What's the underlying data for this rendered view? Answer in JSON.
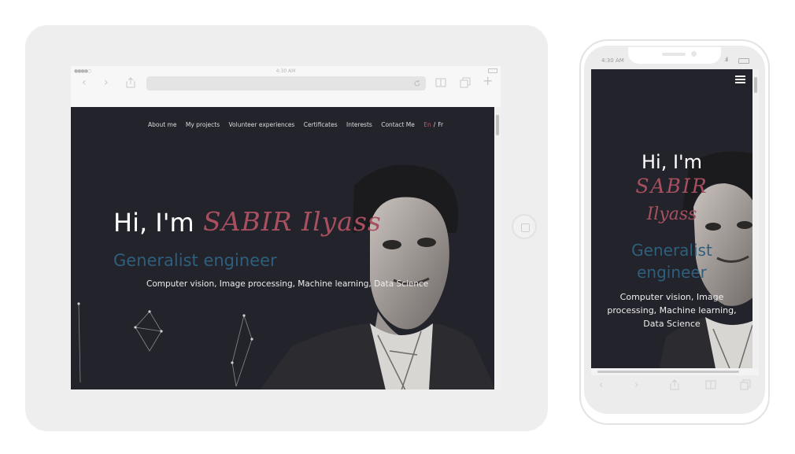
{
  "tablet": {
    "status_time": "4:30 AM",
    "nav": {
      "items": [
        "About me",
        "My projects",
        "Volunteer experiences",
        "Certificates",
        "Interests",
        "Contact Me"
      ],
      "lang_en": "En",
      "lang_sep": "/",
      "lang_fr": "Fr"
    },
    "hero": {
      "greeting": "Hi, I'm",
      "name": "SABIR Ilyass",
      "role": "Generalist engineer",
      "skills": "Computer vision, Image processing, Machine learning, Data Science"
    }
  },
  "phone": {
    "status_time": "4:30 AM",
    "hero": {
      "greeting": "Hi, I'm",
      "name_line1": "SABIR",
      "name_line2": "Ilyass",
      "role_line1": "Generalist",
      "role_line2": "engineer",
      "skills": "Computer vision, Image processing, Machine learning, Data Science"
    }
  },
  "colors": {
    "page_bg": "#23232b",
    "name_accent": "#a8505f",
    "role_accent": "#2e5f7d",
    "device_frame": "#eeeeee"
  },
  "icons": [
    "back-icon",
    "forward-icon",
    "share-icon",
    "reload-icon",
    "book-icon",
    "tabs-icon",
    "plus-icon",
    "hamburger-menu-icon"
  ]
}
